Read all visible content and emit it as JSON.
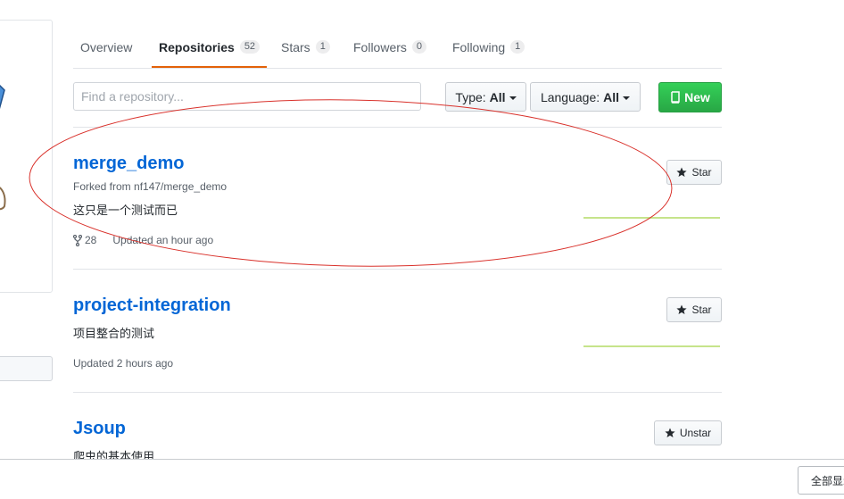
{
  "tabs": [
    {
      "label": "Overview"
    },
    {
      "label": "Repositories",
      "count": "52"
    },
    {
      "label": "Stars",
      "count": "1"
    },
    {
      "label": "Followers",
      "count": "0"
    },
    {
      "label": "Following",
      "count": "1"
    }
  ],
  "filters": {
    "search_placeholder": "Find a repository...",
    "type_label": "Type:",
    "type_value": "All",
    "language_label": "Language:",
    "language_value": "All",
    "new_label": "New"
  },
  "repos": [
    {
      "name": "merge_demo",
      "forked_from": "Forked from nf147/merge_demo",
      "description": "这只是一个测试而已",
      "forks": "28",
      "updated": "Updated an hour ago",
      "star_label": "Star"
    },
    {
      "name": "project-integration",
      "description": "项目整合的测试",
      "updated": "Updated 2 hours ago",
      "star_label": "Star"
    },
    {
      "name": "Jsoup",
      "description": "爬虫的基本使用",
      "star_label": "Unstar"
    }
  ],
  "bottom_bar": {
    "show_all_label": "全部显示"
  },
  "colors": {
    "link": "#0366d6",
    "tab_underline": "#e36209",
    "new_button": "#28a745",
    "annotation_ellipse": "#d9312b",
    "sparkline": "#c6e48b"
  }
}
